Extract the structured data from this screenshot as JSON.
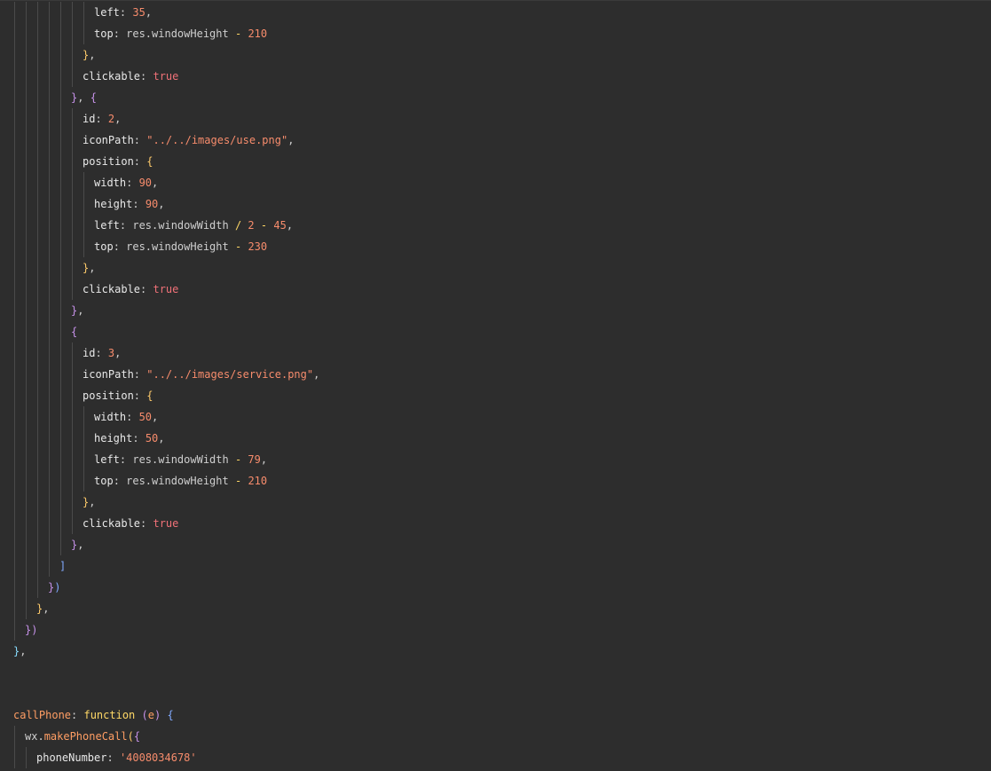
{
  "editor": {
    "colors": {
      "background": "#2d2d2d",
      "text": "#e8e8e8",
      "number": "#f78c6c",
      "string": "#f78c6c",
      "keyword": "#f07178",
      "operator": "#ffd866",
      "function_keyword": "#ffd866",
      "method_name": "#ff9e64",
      "bracket_level_1": "#ffcb6b",
      "bracket_level_2": "#c792ea",
      "bracket_level_3": "#82aaff",
      "bracket_level_4": "#89ddff",
      "indent_guide": "#4a4a4a"
    },
    "lines": [
      {
        "tokens": [
          {
            "t": "left",
            "c": "prop"
          },
          {
            "t": ": ",
            "c": "punc"
          },
          {
            "t": "35",
            "c": "num"
          },
          {
            "t": ",",
            "c": "punc"
          }
        ]
      },
      {
        "tokens": [
          {
            "t": "top",
            "c": "prop"
          },
          {
            "t": ": res.windowHeight ",
            "c": "punc"
          },
          {
            "t": "-",
            "c": "op"
          },
          {
            "t": " ",
            "c": "punc"
          },
          {
            "t": "210",
            "c": "num"
          }
        ]
      },
      {
        "tokens": [
          {
            "t": "}",
            "c": "b1"
          },
          {
            "t": ",",
            "c": "punc"
          }
        ]
      },
      {
        "tokens": [
          {
            "t": "clickable",
            "c": "prop"
          },
          {
            "t": ": ",
            "c": "punc"
          },
          {
            "t": "true",
            "c": "kw"
          }
        ]
      },
      {
        "tokens": [
          {
            "t": "}",
            "c": "b2"
          },
          {
            "t": ", ",
            "c": "punc"
          },
          {
            "t": "{",
            "c": "b2"
          }
        ]
      },
      {
        "tokens": [
          {
            "t": "id",
            "c": "prop"
          },
          {
            "t": ": ",
            "c": "punc"
          },
          {
            "t": "2",
            "c": "num"
          },
          {
            "t": ",",
            "c": "punc"
          }
        ]
      },
      {
        "tokens": [
          {
            "t": "iconPath",
            "c": "prop"
          },
          {
            "t": ": ",
            "c": "punc"
          },
          {
            "t": "\"../../images/use.png\"",
            "c": "str"
          },
          {
            "t": ",",
            "c": "punc"
          }
        ]
      },
      {
        "tokens": [
          {
            "t": "position",
            "c": "prop"
          },
          {
            "t": ": ",
            "c": "punc"
          },
          {
            "t": "{",
            "c": "b1"
          }
        ]
      },
      {
        "tokens": [
          {
            "t": "width",
            "c": "prop"
          },
          {
            "t": ": ",
            "c": "punc"
          },
          {
            "t": "90",
            "c": "num"
          },
          {
            "t": ",",
            "c": "punc"
          }
        ]
      },
      {
        "tokens": [
          {
            "t": "height",
            "c": "prop"
          },
          {
            "t": ": ",
            "c": "punc"
          },
          {
            "t": "90",
            "c": "num"
          },
          {
            "t": ",",
            "c": "punc"
          }
        ]
      },
      {
        "tokens": [
          {
            "t": "left",
            "c": "prop"
          },
          {
            "t": ": res.windowWidth ",
            "c": "punc"
          },
          {
            "t": "/",
            "c": "op"
          },
          {
            "t": " ",
            "c": "punc"
          },
          {
            "t": "2",
            "c": "num"
          },
          {
            "t": " ",
            "c": "punc"
          },
          {
            "t": "-",
            "c": "op"
          },
          {
            "t": " ",
            "c": "punc"
          },
          {
            "t": "45",
            "c": "num"
          },
          {
            "t": ",",
            "c": "punc"
          }
        ]
      },
      {
        "tokens": [
          {
            "t": "top",
            "c": "prop"
          },
          {
            "t": ": res.windowHeight ",
            "c": "punc"
          },
          {
            "t": "-",
            "c": "op"
          },
          {
            "t": " ",
            "c": "punc"
          },
          {
            "t": "230",
            "c": "num"
          }
        ]
      },
      {
        "tokens": [
          {
            "t": "}",
            "c": "b1"
          },
          {
            "t": ",",
            "c": "punc"
          }
        ]
      },
      {
        "tokens": [
          {
            "t": "clickable",
            "c": "prop"
          },
          {
            "t": ": ",
            "c": "punc"
          },
          {
            "t": "true",
            "c": "kw"
          }
        ]
      },
      {
        "tokens": [
          {
            "t": "}",
            "c": "b2"
          },
          {
            "t": ",",
            "c": "punc"
          }
        ]
      },
      {
        "tokens": [
          {
            "t": "{",
            "c": "b2"
          }
        ]
      },
      {
        "tokens": [
          {
            "t": "id",
            "c": "prop"
          },
          {
            "t": ": ",
            "c": "punc"
          },
          {
            "t": "3",
            "c": "num"
          },
          {
            "t": ",",
            "c": "punc"
          }
        ]
      },
      {
        "tokens": [
          {
            "t": "iconPath",
            "c": "prop"
          },
          {
            "t": ": ",
            "c": "punc"
          },
          {
            "t": "\"../../images/service.png\"",
            "c": "str"
          },
          {
            "t": ",",
            "c": "punc"
          }
        ]
      },
      {
        "tokens": [
          {
            "t": "position",
            "c": "prop"
          },
          {
            "t": ": ",
            "c": "punc"
          },
          {
            "t": "{",
            "c": "b1"
          }
        ]
      },
      {
        "tokens": [
          {
            "t": "width",
            "c": "prop"
          },
          {
            "t": ": ",
            "c": "punc"
          },
          {
            "t": "50",
            "c": "num"
          },
          {
            "t": ",",
            "c": "punc"
          }
        ]
      },
      {
        "tokens": [
          {
            "t": "height",
            "c": "prop"
          },
          {
            "t": ": ",
            "c": "punc"
          },
          {
            "t": "50",
            "c": "num"
          },
          {
            "t": ",",
            "c": "punc"
          }
        ]
      },
      {
        "tokens": [
          {
            "t": "left",
            "c": "prop"
          },
          {
            "t": ": res.windowWidth ",
            "c": "punc"
          },
          {
            "t": "-",
            "c": "op"
          },
          {
            "t": " ",
            "c": "punc"
          },
          {
            "t": "79",
            "c": "num"
          },
          {
            "t": ",",
            "c": "punc"
          }
        ]
      },
      {
        "tokens": [
          {
            "t": "top",
            "c": "prop"
          },
          {
            "t": ": res.windowHeight ",
            "c": "punc"
          },
          {
            "t": "-",
            "c": "op"
          },
          {
            "t": " ",
            "c": "punc"
          },
          {
            "t": "210",
            "c": "num"
          }
        ]
      },
      {
        "tokens": [
          {
            "t": "}",
            "c": "b1"
          },
          {
            "t": ",",
            "c": "punc"
          }
        ]
      },
      {
        "tokens": [
          {
            "t": "clickable",
            "c": "prop"
          },
          {
            "t": ": ",
            "c": "punc"
          },
          {
            "t": "true",
            "c": "kw"
          }
        ]
      },
      {
        "tokens": [
          {
            "t": "}",
            "c": "b2"
          },
          {
            "t": ",",
            "c": "punc"
          }
        ]
      },
      {
        "tokens": [
          {
            "t": "]",
            "c": "b3"
          }
        ]
      },
      {
        "tokens": [
          {
            "t": "}",
            "c": "b2"
          },
          {
            "t": ")",
            "c": "b3"
          }
        ]
      },
      {
        "tokens": [
          {
            "t": "}",
            "c": "b1"
          },
          {
            "t": ",",
            "c": "punc"
          }
        ]
      },
      {
        "tokens": [
          {
            "t": "}",
            "c": "b2"
          },
          {
            "t": ")",
            "c": "b2"
          }
        ]
      },
      {
        "tokens": [
          {
            "t": "}",
            "c": "b4"
          },
          {
            "t": ",",
            "c": "punc"
          }
        ]
      },
      {
        "tokens": []
      },
      {
        "tokens": []
      },
      {
        "tokens": [
          {
            "t": "callPhone",
            "c": "fn"
          },
          {
            "t": ": ",
            "c": "punc"
          },
          {
            "t": "function",
            "c": "func"
          },
          {
            "t": " ",
            "c": "punc"
          },
          {
            "t": "(",
            "c": "b2"
          },
          {
            "t": "e",
            "c": "fn"
          },
          {
            "t": ")",
            "c": "b2"
          },
          {
            "t": " ",
            "c": "punc"
          },
          {
            "t": "{",
            "c": "b3"
          }
        ]
      },
      {
        "tokens": [
          {
            "t": "wx.",
            "c": "punc"
          },
          {
            "t": "makePhoneCall",
            "c": "fn"
          },
          {
            "t": "(",
            "c": "b1"
          },
          {
            "t": "{",
            "c": "b2"
          }
        ]
      },
      {
        "tokens": [
          {
            "t": "phoneNumber",
            "c": "prop"
          },
          {
            "t": ": ",
            "c": "punc"
          },
          {
            "t": "'4008034678'",
            "c": "str"
          }
        ]
      }
    ]
  }
}
